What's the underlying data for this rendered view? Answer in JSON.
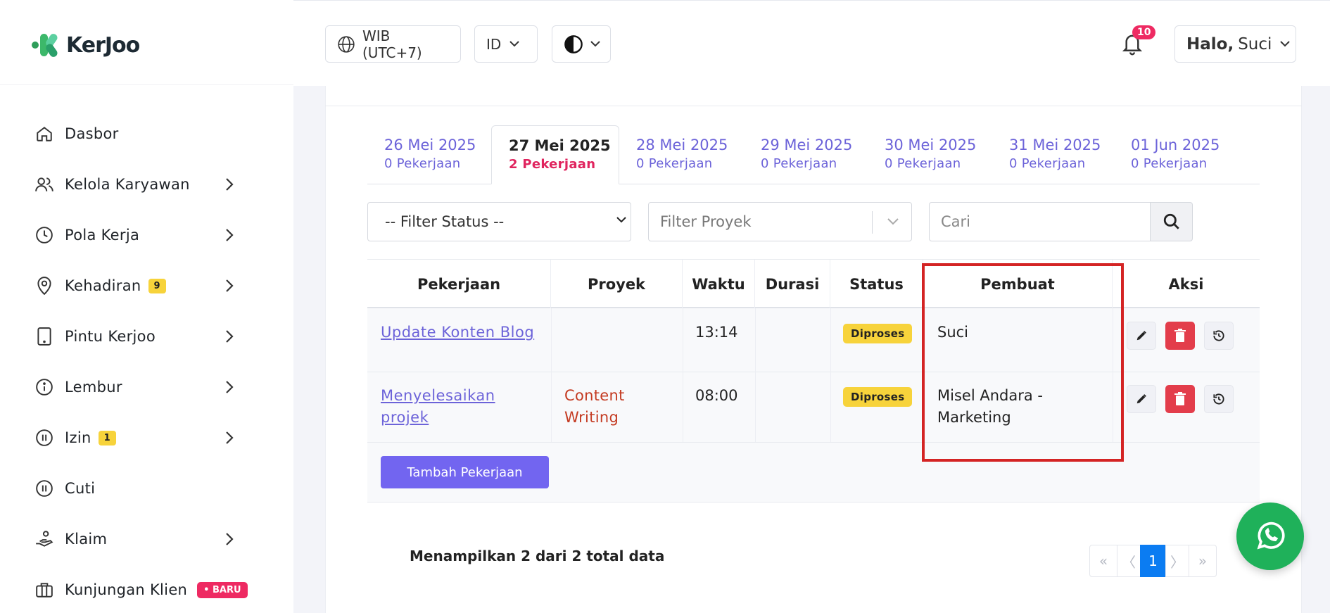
{
  "logo": {
    "text": "KerJoo"
  },
  "sidebar": {
    "items": [
      {
        "label": "Dasbor",
        "icon": "home-icon",
        "chevron": false
      },
      {
        "label": "Kelola Karyawan",
        "icon": "users-icon",
        "chevron": true
      },
      {
        "label": "Pola Kerja",
        "icon": "clock-icon",
        "chevron": true
      },
      {
        "label": "Kehadiran",
        "icon": "map-pin-icon",
        "chevron": true,
        "badge": "9"
      },
      {
        "label": "Pintu Kerjoo",
        "icon": "tablet-icon",
        "chevron": true
      },
      {
        "label": "Lembur",
        "icon": "info-icon",
        "chevron": true
      },
      {
        "label": "Izin",
        "icon": "pause-circle-icon",
        "chevron": true,
        "badge": "1"
      },
      {
        "label": "Cuti",
        "icon": "pause-circle-icon",
        "chevron": false
      },
      {
        "label": "Klaim",
        "icon": "hand-coin-icon",
        "chevron": true
      },
      {
        "label": "Kunjungan Klien",
        "icon": "briefcase-icon",
        "chevron": false,
        "badge_new": "• BARU"
      }
    ]
  },
  "header": {
    "timezone": "WIB (UTC+7)",
    "language": "ID",
    "notif_count": "10",
    "greeting": "Halo,",
    "user": "Suci"
  },
  "tabs": [
    {
      "date": "26 Mei 2025",
      "count": "0 Pekerjaan"
    },
    {
      "date": "27 Mei 2025",
      "count": "2 Pekerjaan",
      "active": true
    },
    {
      "date": "28 Mei 2025",
      "count": "0 Pekerjaan"
    },
    {
      "date": "29 Mei 2025",
      "count": "0 Pekerjaan"
    },
    {
      "date": "30 Mei 2025",
      "count": "0 Pekerjaan"
    },
    {
      "date": "31 Mei 2025",
      "count": "0 Pekerjaan"
    },
    {
      "date": "01 Jun 2025",
      "count": "0 Pekerjaan"
    }
  ],
  "filters": {
    "status": "-- Filter Status --",
    "project_placeholder": "Filter Proyek",
    "search_placeholder": "Cari"
  },
  "table": {
    "headers": [
      "Pekerjaan",
      "Proyek",
      "Waktu",
      "Durasi",
      "Status",
      "Pembuat",
      "Aksi"
    ],
    "rows": [
      {
        "task": "Update Konten Blog",
        "project": "",
        "time": "13:14",
        "duration": "",
        "status": "Diproses",
        "creator": "Suci"
      },
      {
        "task_line1": "Menyelesaikan",
        "task_line2": "projek",
        "project_line1": "Content",
        "project_line2": "Writing",
        "time": "08:00",
        "duration": "",
        "status": "Diproses",
        "creator_line1": "Misel Andara -",
        "creator_line2": "Marketing"
      }
    ]
  },
  "add_button": "Tambah Pekerjaan",
  "summary": "Menampilkan 2 dari 2 total data",
  "pagination": {
    "first": "«",
    "prev": "〈",
    "current": "1",
    "next": "〉",
    "last": "»"
  },
  "colors": {
    "accent": "#6c63d9",
    "primary_button": "#7265f0",
    "danger": "#e33d4b",
    "status": "#f7d33b",
    "highlight": "#d42424",
    "whatsapp": "#1fb15a"
  }
}
